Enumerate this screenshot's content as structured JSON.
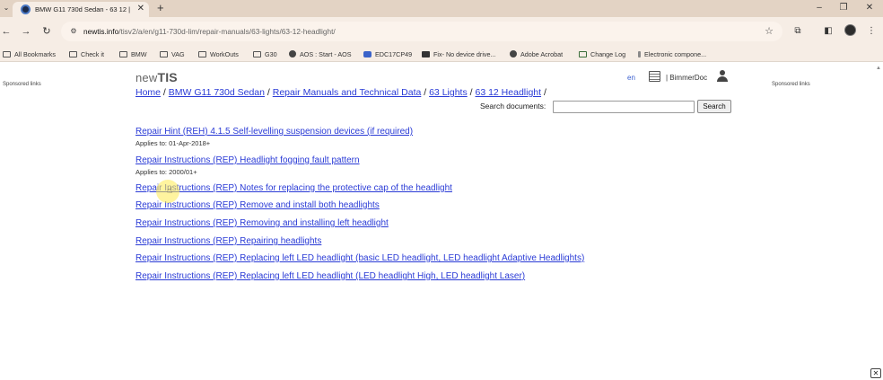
{
  "browser": {
    "tab_title": "BMW G11 730d Sedan - 63 12 |",
    "tab_close": "✕",
    "new_tab": "+",
    "url_host": "newtis.info",
    "url_path": "/tisv2/a/en/g11-730d-lim/repair-manuals/63-lights/63-12-headlight/",
    "bookmarks": [
      {
        "label": "All Bookmarks",
        "icon": "folder-icon"
      },
      {
        "label": "Check it",
        "icon": "folder-icon"
      },
      {
        "label": "BMW",
        "icon": "folder-icon"
      },
      {
        "label": "VAG",
        "icon": "folder-icon"
      },
      {
        "label": "WorkOuts",
        "icon": "folder-icon"
      },
      {
        "label": "G30",
        "icon": "folder-icon"
      },
      {
        "label": "AOS : Start - AOS",
        "icon": "globe-icon"
      },
      {
        "label": "EDC17CP49",
        "icon": "site-icon"
      },
      {
        "label": "Fix- No device drive...",
        "icon": "site-icon"
      },
      {
        "label": "Adobe Acrobat",
        "icon": "globe-icon"
      },
      {
        "label": "Change Log",
        "icon": "site-icon"
      },
      {
        "label": "Electronic compone...",
        "icon": "site-icon"
      }
    ]
  },
  "page": {
    "sponsored_left": "Sponsored links",
    "sponsored_right": "Sponsored links",
    "logo_prefix": "new",
    "logo_bold": "TIS",
    "lang": "en",
    "user": "| BimmerDoc",
    "breadcrumb": [
      {
        "label": "Home",
        "link": true
      },
      {
        "label": "BMW G11 730d Sedan",
        "link": true
      },
      {
        "label": "Repair Manuals and Technical Data",
        "link": true
      },
      {
        "label": "63 Lights",
        "link": true
      },
      {
        "label": "63 12 Headlight",
        "link": true
      }
    ],
    "search_label": "Search documents:",
    "search_value": "",
    "search_button": "Search",
    "documents": [
      {
        "title": "Repair Hint (REH) 4.1.5 Self-levelling suspension devices (if required)",
        "applies": "Applies to: 01-Apr-2018+"
      },
      {
        "title": "Repair Instructions (REP) Headlight fogging fault pattern",
        "applies": "Applies to: 2000/01+"
      },
      {
        "title": "Repair Instructions (REP) Notes for replacing the protective cap of the headlight",
        "applies": ""
      },
      {
        "title": "Repair Instructions (REP) Remove and install both headlights",
        "applies": ""
      },
      {
        "title": "Repair Instructions (REP) Removing and installing left headlight",
        "applies": ""
      },
      {
        "title": "Repair Instructions (REP) Repairing headlights",
        "applies": ""
      },
      {
        "title": "Repair Instructions (REP) Replacing left LED headlight (basic LED headlight, LED headlight Adaptive Headlights)",
        "applies": ""
      },
      {
        "title": "Repair Instructions (REP) Replacing left LED headlight (LED headlight High, LED headlight Laser)",
        "applies": ""
      }
    ]
  }
}
